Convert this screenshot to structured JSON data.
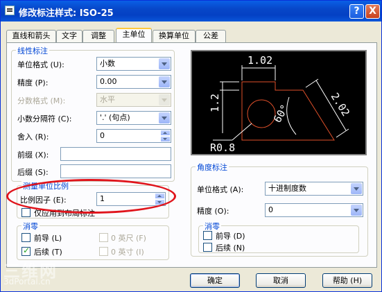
{
  "window": {
    "title": "修改标注样式: ISO-25",
    "help_btn": "?",
    "close_btn": "X"
  },
  "tabs": [
    {
      "label": "直线和箭头"
    },
    {
      "label": "文字"
    },
    {
      "label": "调整"
    },
    {
      "label": "主单位",
      "active": true
    },
    {
      "label": "换算单位"
    },
    {
      "label": "公差"
    }
  ],
  "linear": {
    "title": "线性标注",
    "unit_format_label": "单位格式 (U):",
    "unit_format_value": "小数",
    "precision_label": "精度 (P):",
    "precision_value": "0.00",
    "fraction_format_label": "分数格式 (M):",
    "fraction_format_value": "水平",
    "decimal_sep_label": "小数分隔符 (C):",
    "decimal_sep_value": "'.' (句点)",
    "round_label": "舍入 (R):",
    "round_value": "0",
    "prefix_label": "前缀 (X):",
    "prefix_value": "",
    "suffix_label": "后缀 (S):",
    "suffix_value": ""
  },
  "scale": {
    "title": "测量单位比例",
    "factor_label": "比例因子 (E):",
    "factor_value": "1",
    "layout_only_label": "仅应用到布局标注"
  },
  "zero_left": {
    "title": "消零",
    "leading_label": "前导 (L)",
    "trailing_label": "后续 (T)",
    "feet_label": "0 英尺 (F)",
    "inches_label": "0 英寸 (I)"
  },
  "preview": {
    "dim_top": "1.02",
    "dim_left": "1.2",
    "dim_diag": "2.02",
    "dim_angle": "60°",
    "dim_radius": "R0.8"
  },
  "angular": {
    "title": "角度标注",
    "unit_format_label": "单位格式 (A):",
    "unit_format_value": "十进制度数",
    "precision_label": "精度 (O):",
    "precision_value": "0"
  },
  "zero_right": {
    "title": "消零",
    "leading_label": "前导 (D)",
    "trailing_label": "后续 (N)"
  },
  "buttons": {
    "ok": "确定",
    "cancel": "取消",
    "help": "帮助 (H)"
  },
  "watermark": {
    "line1": "三维网",
    "line2": "3dPortal.cn"
  }
}
